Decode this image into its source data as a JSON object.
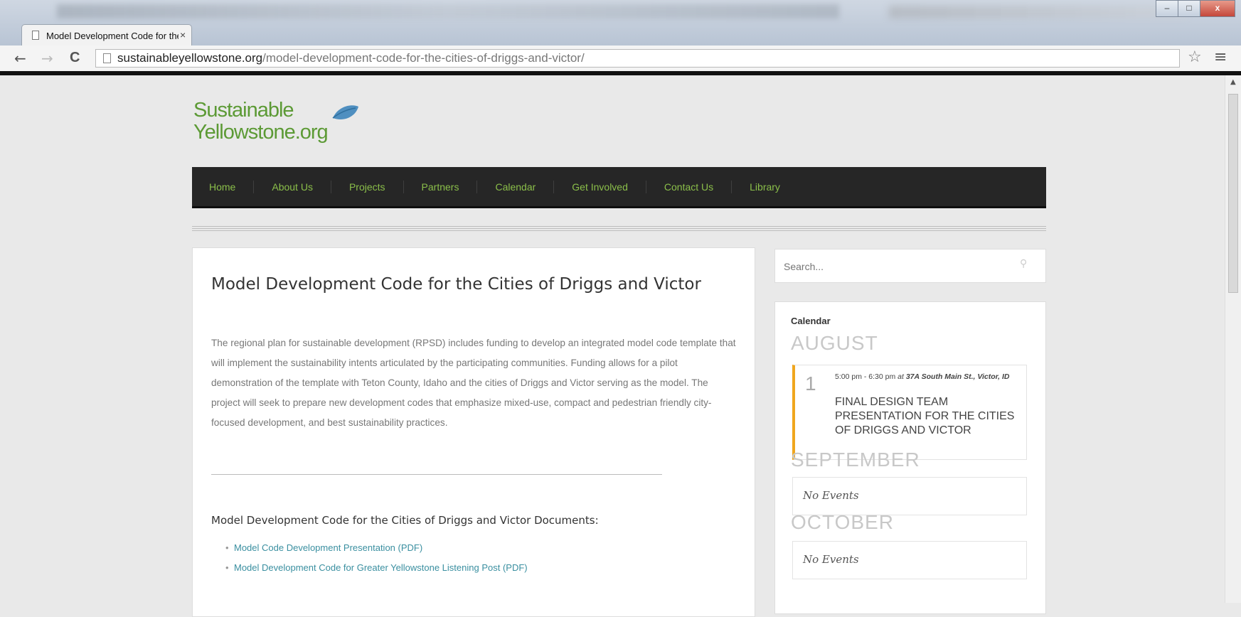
{
  "browser": {
    "tab_title": "Model Development Code for the Cities of Driggs and Victor",
    "tab_close": "×",
    "url_host": "sustainableyellowstone.org",
    "url_path": "/model-development-code-for-the-cities-of-driggs-and-victor/",
    "nav": {
      "back": "←",
      "forward": "→",
      "reload": "C"
    },
    "window_controls": {
      "minimize": "–",
      "maximize": "□",
      "close": "x"
    }
  },
  "site": {
    "logo_line1": "Sustainable",
    "logo_line2": "Yellowstone.org",
    "nav_items": [
      "Home",
      "About Us",
      "Projects",
      "Partners",
      "Calendar",
      "Get Involved",
      "Contact Us",
      "Library"
    ]
  },
  "article": {
    "title": "Model Development Code for the Cities of Driggs and Victor",
    "body": "The regional plan for sustainable development (RPSD) includes funding to develop an integrated model code template that will implement the sustainability intents articulated by the participating communities. Funding allows for a pilot demonstration of the template with Teton County, Idaho and the cities of Driggs and Victor serving as the model. The project will seek to prepare new development codes that emphasize mixed-use, compact and pedestrian friendly city-focused development, and best sustainability practices.",
    "documents_heading": "Model Development Code for the Cities of Driggs and Victor Documents:",
    "documents": [
      "Model Code Development Presentation (PDF)",
      "Model Development Code for Greater Yellowstone Listening Post (PDF)"
    ]
  },
  "sidebar": {
    "search_placeholder": "Search...",
    "calendar_title": "Calendar",
    "months": [
      {
        "name": "AUGUST"
      },
      {
        "name": "SEPTEMBER",
        "empty_text": "No Events"
      },
      {
        "name": "OCTOBER",
        "empty_text": "No Events"
      }
    ],
    "event": {
      "day": "1",
      "time": "5:00 pm - 6:30 pm",
      "at": "at",
      "location": "37A South Main St., Victor, ID",
      "title": "Final Design Team Presentation for the Cities of Driggs and Victor"
    }
  },
  "colors": {
    "accent_green": "#8bbf4a",
    "nav_bg": "#262626",
    "link": "#3a8fa0",
    "event_bar": "#f0a61e"
  }
}
